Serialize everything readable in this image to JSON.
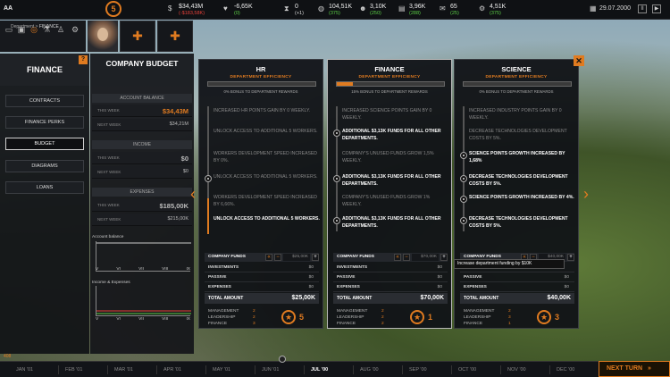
{
  "topbar": {
    "company": "AA",
    "level": "5",
    "money": {
      "value": "$34,43M",
      "delta": "(-$183,58K)"
    },
    "heart": {
      "value": "-6,65K",
      "delta": "(0)"
    },
    "clock": {
      "value": "0",
      "delta": "(+1)"
    },
    "people": {
      "value": "104,51K",
      "delta": "(375)"
    },
    "persons": {
      "value": "3,10K",
      "delta": "(250)"
    },
    "database": {
      "value": "3,96K",
      "delta": "(288)"
    },
    "mail": {
      "value": "65",
      "delta": "(25)"
    },
    "gear": {
      "value": "4,51K",
      "delta": "(375)"
    },
    "date": "29.07.2000",
    "pause": "II",
    "play": "▶"
  },
  "breadcrumb": {
    "prefix": "Department >",
    "current": "FINANCE"
  },
  "left_panel": {
    "title": "FINANCE",
    "help": "?",
    "nav": [
      "CONTRACTS",
      "FINANCE PERKS",
      "BUDGET",
      "DIAGRAMS",
      "LOANS"
    ]
  },
  "budget": {
    "title": "COMPANY BUDGET",
    "account_balance": {
      "header": "ACCOUNT BALANCE",
      "this_week_label": "THIS WEEK",
      "this_week_value": "$34,43M",
      "next_week_label": "NEXT WEEK",
      "next_week_value": "$34,21M"
    },
    "income": {
      "header": "INCOME",
      "this_week_label": "THIS WEEK",
      "this_week_value": "$0",
      "next_week_label": "NEXT WEEK",
      "next_week_value": "$0"
    },
    "expenses": {
      "header": "EXPENSES",
      "this_week_label": "THIS WEEK",
      "this_week_value": "$185,00K",
      "next_week_label": "NEXT WEEK",
      "next_week_value": "$215,00K"
    },
    "chart1_label": "Account balance",
    "chart2_label": "Income & Expenses",
    "months": [
      "V",
      "VI",
      "VII",
      "VIII",
      "IX"
    ]
  },
  "departments": [
    {
      "name": "HR",
      "efficiency_label": "DEPARTMENT EFFICIENCY",
      "efficiency": 0,
      "bonus": "0% BONUS TO DEPARTMENT REWARDS",
      "perks": [
        {
          "text": "INCREASED HR POINTS GAIN BY 0 WEEKLY.",
          "on": false
        },
        {
          "text": "UNLOCK ACCESS TO ADDITIONAL 5 WORKERS.",
          "on": false
        },
        {
          "text": "WORKERS DEVELOPMENT SPEED INCREASED BY 0%.",
          "on": false
        },
        {
          "text": "UNLOCK ACCESS TO ADDITIONAL 5 WORKERS.",
          "on": false
        },
        {
          "text": "WORKERS DEVELOPMENT SPEED INCREASED BY 6,66%.",
          "on": false
        },
        {
          "text": "UNLOCK ACCESS TO ADDITIONAL 5 WORKERS.",
          "on": true
        }
      ],
      "funds_label": "COMPANY FUNDS",
      "funds_value": "$25,00K",
      "investments_label": "INVESTMENTS",
      "investments": "$0",
      "passive_label": "PASSIVE",
      "passive": "$0",
      "expenses_label": "EXPENSES",
      "expenses": "$0",
      "total_label": "TOTAL AMOUNT",
      "total": "$25,00K",
      "management_label": "MANAGEMENT",
      "management": "2",
      "leadership_label": "LEADERSHIP",
      "leadership": "2",
      "finance_label": "FINANCE",
      "finance": "3",
      "stars": "5"
    },
    {
      "name": "FINANCE",
      "efficiency_label": "DEPARTMENT EFFICIENCY",
      "efficiency": 0.15,
      "bonus": "15% BONUS TO DEPARTMENT REWARDS",
      "perks": [
        {
          "text": "INCREASED SCIENCE POINTS GAIN BY 0 WEEKLY.",
          "on": false
        },
        {
          "text": "ADDITIONAL $3,13K FUNDS FOR ALL OTHER DEPARTMENTS.",
          "on": true
        },
        {
          "text": "COMPANY'S UNUSED FUNDS GROW 1,5% WEEKLY.",
          "on": false
        },
        {
          "text": "ADDITIONAL $3,13K FUNDS FOR ALL OTHER DEPARTMENTS.",
          "on": true
        },
        {
          "text": "COMPANY'S UNUSED FUNDS GROW 1% WEEKLY.",
          "on": false
        },
        {
          "text": "ADDITIONAL $3,13K FUNDS FOR ALL OTHER DEPARTMENTS.",
          "on": true
        }
      ],
      "funds_label": "COMPANY FUNDS",
      "funds_value": "$70,00K",
      "investments_label": "INVESTMENTS",
      "investments": "$0",
      "passive_label": "PASSIVE",
      "passive": "$0",
      "expenses_label": "EXPENSES",
      "expenses": "$0",
      "total_label": "TOTAL AMOUNT",
      "total": "$70,00K",
      "management_label": "MANAGEMENT",
      "management": "2",
      "leadership_label": "LEADERSHIP",
      "leadership": "2",
      "finance_label": "FINANCE",
      "finance": "2",
      "stars": "1"
    },
    {
      "name": "SCIENCE",
      "efficiency_label": "DEPARTMENT EFFICIENCY",
      "efficiency": 0,
      "bonus": "0% BONUS TO DEPARTMENT REWARDS",
      "perks": [
        {
          "text": "INCREASED INDUSTRY POINTS GAIN BY 0 WEEKLY.",
          "on": false
        },
        {
          "text": "DECREASE TECHNOLOGIES DEVELOPMENT COSTS BY 5%.",
          "on": false
        },
        {
          "text": "SCIENCE POINTS GROWTH INCREASED BY 1,68%",
          "on": true
        },
        {
          "text": "DECREASE TECHNOLOGIES DEVELOPMENT COSTS BY 5%.",
          "on": true
        },
        {
          "text": "SCIENCE POINTS GROWTH INCREASED BY 4%.",
          "on": true
        },
        {
          "text": "DECREASE TECHNOLOGIES DEVELOPMENT COSTS BY 5%.",
          "on": true
        }
      ],
      "funds_label": "COMPANY FUNDS",
      "funds_value": "$40,00K",
      "investments_label": "INVESTMENTS",
      "investments": "",
      "passive_label": "PASSIVE",
      "passive": "$0",
      "expenses_label": "EXPENSES",
      "expenses": "$0",
      "total_label": "TOTAL AMOUNT",
      "total": "$40,00K",
      "management_label": "MANAGEMENT",
      "management": "2",
      "leadership_label": "LEADERSHIP",
      "leadership": "3",
      "finance_label": "FINANCE",
      "finance": "1",
      "stars": "3"
    }
  ],
  "tooltip": "Increase department funding by $10K",
  "timeline": {
    "left_value": "408",
    "months": [
      "JAN '01",
      "FEB '01",
      "MAR '01",
      "APR '01",
      "MAY '01",
      "JUN '01",
      "JUL '00",
      "AUG '00",
      "SEP '00",
      "OCT '00",
      "NOV '00",
      "DEC '00"
    ],
    "current_index": 6
  },
  "next_turn": "NEXT TURN",
  "colors": {
    "accent": "#e07b20",
    "negative": "#e8413a",
    "positive": "#5ccf46"
  }
}
